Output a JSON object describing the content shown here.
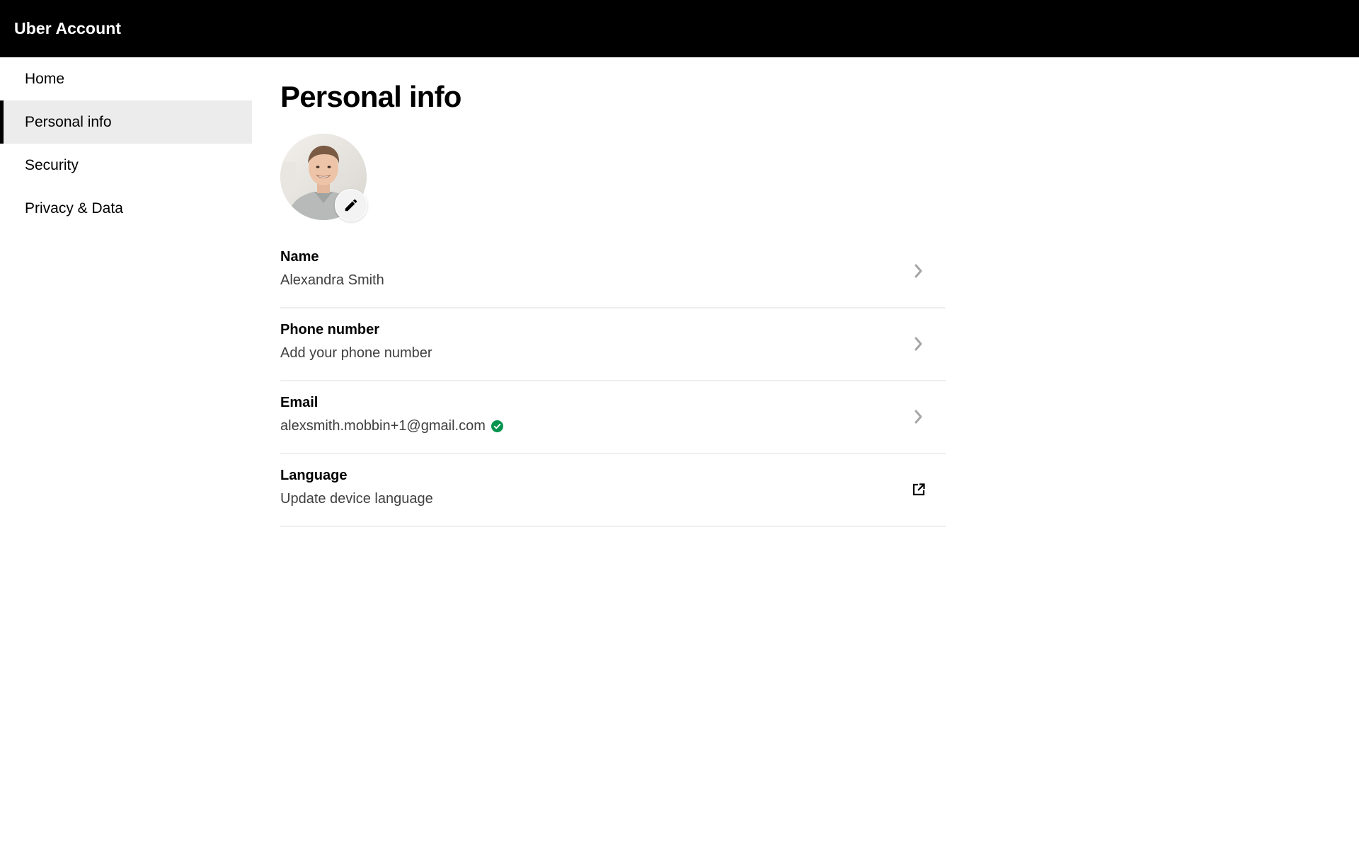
{
  "header": {
    "title": "Uber Account"
  },
  "sidebar": {
    "items": [
      {
        "label": "Home",
        "active": false
      },
      {
        "label": "Personal info",
        "active": true
      },
      {
        "label": "Security",
        "active": false
      },
      {
        "label": "Privacy & Data",
        "active": false
      }
    ]
  },
  "main": {
    "title": "Personal info",
    "avatar": {
      "icon": "pencil-icon"
    },
    "rows": [
      {
        "label": "Name",
        "value": "Alexandra Smith",
        "icon": "chevron-right-icon"
      },
      {
        "label": "Phone number",
        "value": "Add your phone number",
        "icon": "chevron-right-icon"
      },
      {
        "label": "Email",
        "value": "alexsmith.mobbin+1@gmail.com",
        "verified": true,
        "icon": "chevron-right-icon"
      },
      {
        "label": "Language",
        "value": "Update device language",
        "icon": "external-link-icon"
      }
    ]
  },
  "colors": {
    "topbar": "#000000",
    "active_nav_bg": "#ececec",
    "verified_badge": "#05944f",
    "chevron": "#a6a6a6",
    "divider": "#eeeeee"
  }
}
